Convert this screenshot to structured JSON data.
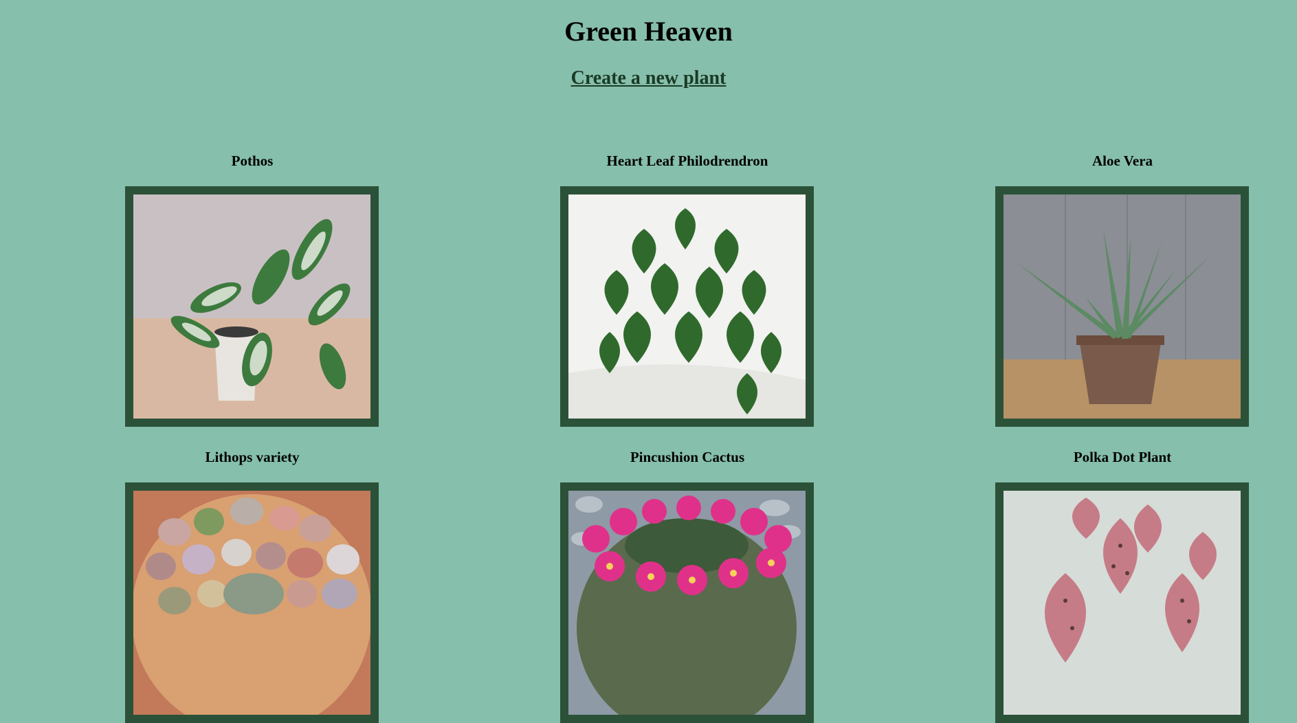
{
  "header": {
    "title": "Green Heaven",
    "create_link": "Create a new plant"
  },
  "plants": [
    {
      "name": "Pothos"
    },
    {
      "name": "Heart Leaf Philodrendron"
    },
    {
      "name": "Aloe Vera"
    },
    {
      "name": "Lithops variety"
    },
    {
      "name": "Pincushion Cactus"
    },
    {
      "name": "Polka Dot Plant"
    }
  ],
  "colors": {
    "background": "#86bfab",
    "frame": "#2b5138",
    "link": "#1a3a26"
  }
}
